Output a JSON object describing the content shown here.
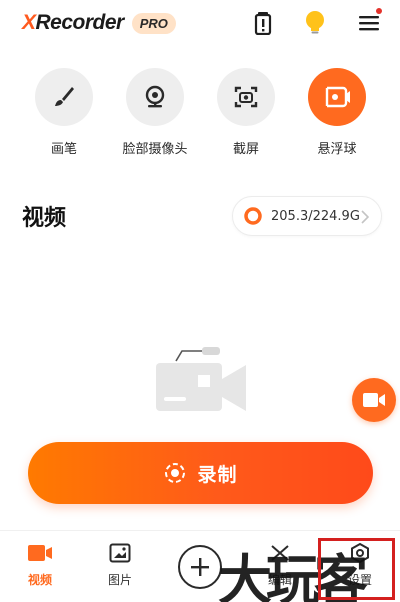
{
  "app": {
    "logo_x": "X",
    "logo_rest": "Recorder",
    "pro_badge": "PRO",
    "accent_color": "#ff6a1f",
    "header_icons": [
      "battery-alert-icon",
      "lightbulb-icon",
      "menu-icon"
    ]
  },
  "features": [
    {
      "label": "画笔",
      "icon": "brush-icon",
      "active": false
    },
    {
      "label": "脸部摄像头",
      "icon": "webcam-icon",
      "active": false
    },
    {
      "label": "截屏",
      "icon": "screenshot-icon",
      "active": false
    },
    {
      "label": "悬浮球",
      "icon": "floating-ball-icon",
      "active": true
    }
  ],
  "section": {
    "title": "视频",
    "storage_text": "205.3/224.9G"
  },
  "record": {
    "label": "录制"
  },
  "bottom_nav": [
    {
      "label": "视频",
      "icon": "video-icon",
      "active": true
    },
    {
      "label": "图片",
      "icon": "image-icon",
      "active": false
    },
    {
      "label": "",
      "icon": "plus-icon",
      "active": false
    },
    {
      "label": "编辑",
      "icon": "edit-icon",
      "active": false
    },
    {
      "label": "设置",
      "icon": "settings-icon",
      "active": false
    }
  ],
  "watermark": {
    "text": "大玩客"
  }
}
